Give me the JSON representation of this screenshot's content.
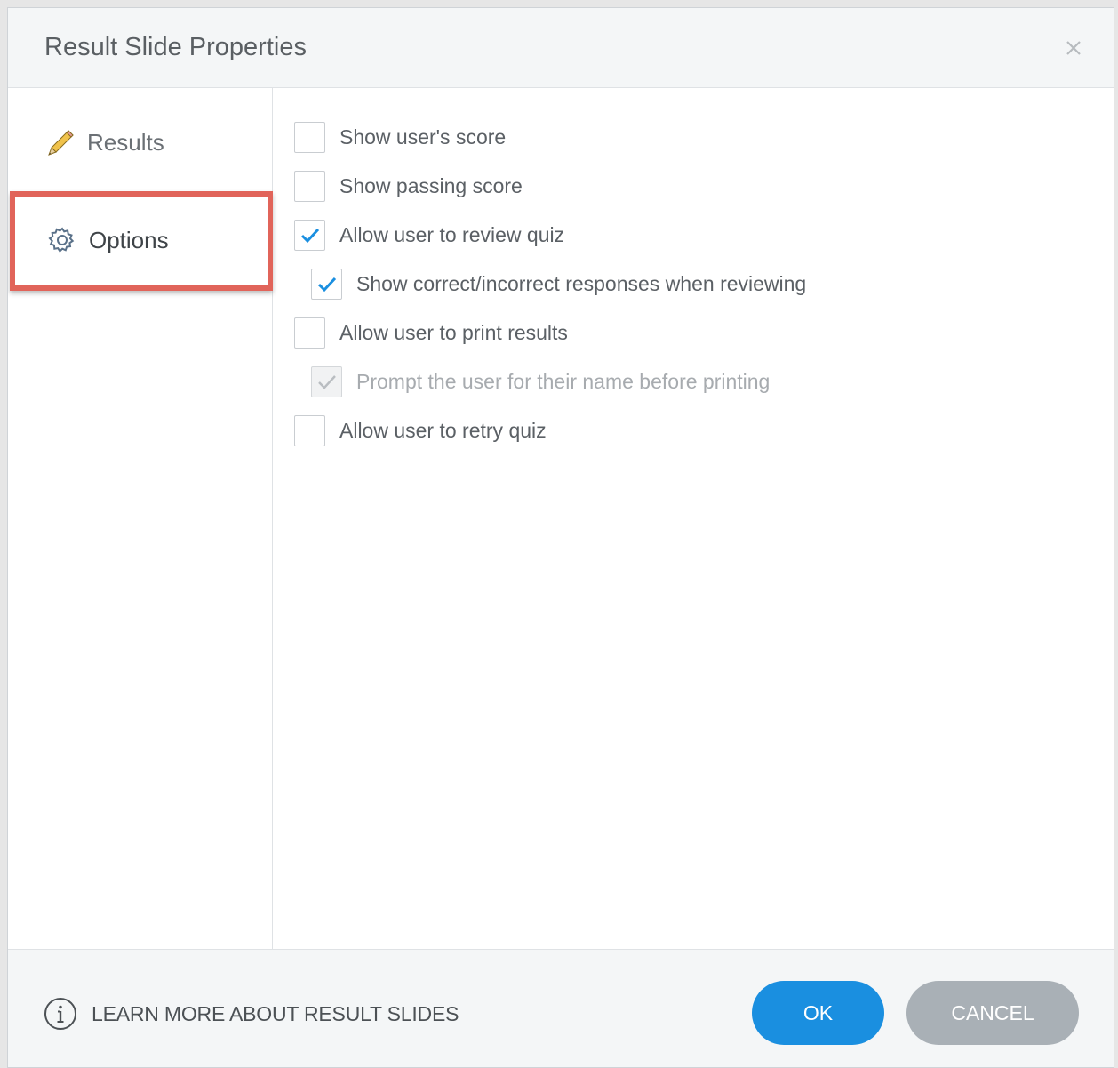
{
  "dialog": {
    "title": "Result Slide Properties"
  },
  "sidebar": {
    "items": [
      {
        "label": "Results",
        "icon": "pencil-icon",
        "selected": false
      },
      {
        "label": "Options",
        "icon": "gear-icon",
        "selected": true
      }
    ],
    "highlight_color": "#e1645a"
  },
  "options": [
    {
      "label": "Show user's score",
      "checked": false,
      "enabled": true,
      "indent": 0
    },
    {
      "label": "Show passing score",
      "checked": false,
      "enabled": true,
      "indent": 0
    },
    {
      "label": "Allow user to review quiz",
      "checked": true,
      "enabled": true,
      "indent": 0
    },
    {
      "label": "Show correct/incorrect responses when reviewing",
      "checked": true,
      "enabled": true,
      "indent": 1
    },
    {
      "label": "Allow user to print results",
      "checked": false,
      "enabled": true,
      "indent": 0
    },
    {
      "label": "Prompt the user for their name before printing",
      "checked": true,
      "enabled": false,
      "indent": 1
    },
    {
      "label": "Allow user to retry quiz",
      "checked": false,
      "enabled": true,
      "indent": 0
    }
  ],
  "footer": {
    "learn_more": "LEARN MORE ABOUT RESULT SLIDES",
    "ok_label": "OK",
    "cancel_label": "CANCEL"
  },
  "colors": {
    "accent": "#1a8fe0",
    "check": "#1a8fe0",
    "check_disabled": "#b9bdc1",
    "cancel": "#a9b0b6"
  }
}
